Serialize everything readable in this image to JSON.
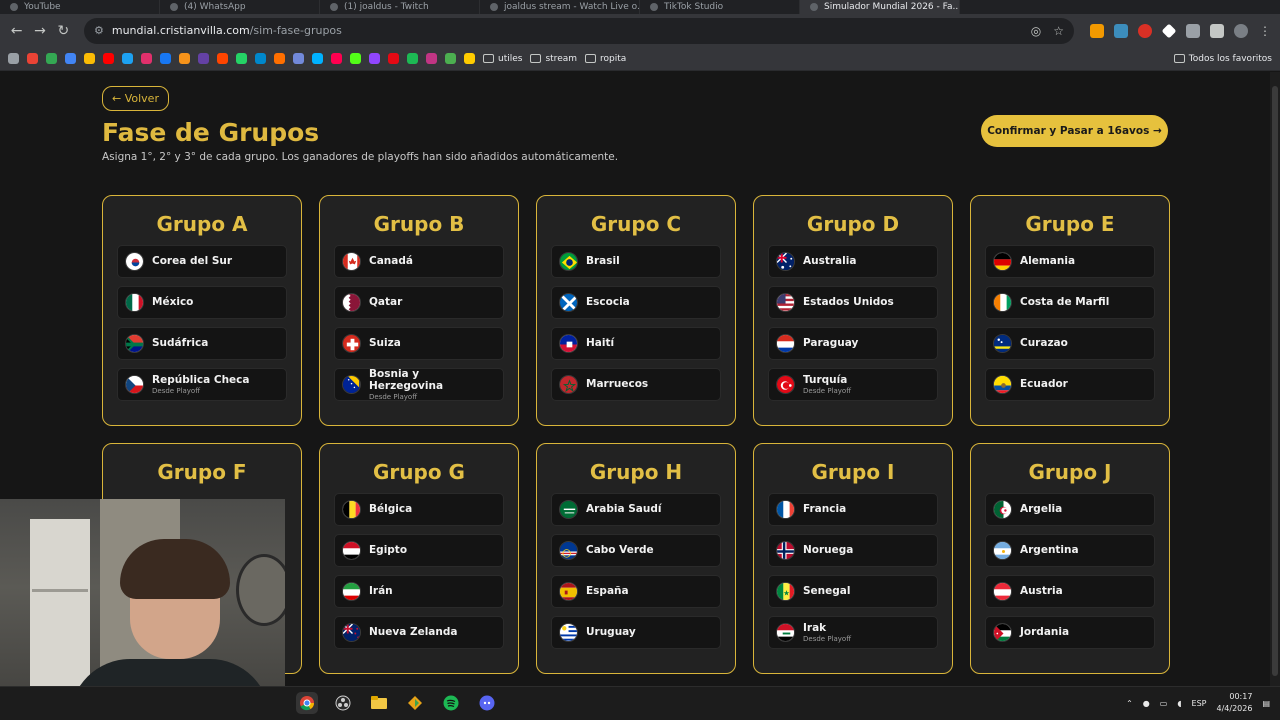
{
  "browser": {
    "tabs": [
      {
        "label": "YouTube",
        "active": false
      },
      {
        "label": "(4) WhatsApp",
        "active": false
      },
      {
        "label": "(1) joaldus - Twitch",
        "active": false
      },
      {
        "label": "joaldus stream - Watch Live o...",
        "active": false
      },
      {
        "label": "TikTok Studio",
        "active": false
      },
      {
        "label": "Simulador Mundial 2026 - Fa...",
        "active": true
      }
    ],
    "url_host": "mundial.cristianvilla.com",
    "url_path": "/sim-fase-grupos",
    "bookmark_folders": [
      "utiles",
      "stream",
      "ropita"
    ],
    "all_bookmarks_label": "Todos los favoritos"
  },
  "header": {
    "back_label": "← Volver",
    "title": "Fase de Grupos",
    "subtitle": "Asigna 1°, 2° y 3° de cada grupo. Los ganadores de playoffs han sido añadidos automáticamente.",
    "confirm_label": "Confirmar y Pasar a 16avos →"
  },
  "groups": [
    {
      "name": "Grupo A",
      "teams": [
        {
          "name": "Corea del Sur",
          "note": "",
          "flag": "kor"
        },
        {
          "name": "México",
          "note": "",
          "flag": "mex"
        },
        {
          "name": "Sudáfrica",
          "note": "",
          "flag": "rsa"
        },
        {
          "name": "República Checa",
          "note": "Desde Playoff",
          "flag": "cze"
        }
      ]
    },
    {
      "name": "Grupo B",
      "teams": [
        {
          "name": "Canadá",
          "note": "",
          "flag": "can"
        },
        {
          "name": "Qatar",
          "note": "",
          "flag": "qat"
        },
        {
          "name": "Suiza",
          "note": "",
          "flag": "sui"
        },
        {
          "name": "Bosnia y Herzegovina",
          "note": "Desde Playoff",
          "flag": "bih"
        }
      ]
    },
    {
      "name": "Grupo C",
      "teams": [
        {
          "name": "Brasil",
          "note": "",
          "flag": "bra"
        },
        {
          "name": "Escocia",
          "note": "",
          "flag": "sco"
        },
        {
          "name": "Haití",
          "note": "",
          "flag": "hai"
        },
        {
          "name": "Marruecos",
          "note": "",
          "flag": "mar"
        }
      ]
    },
    {
      "name": "Grupo D",
      "teams": [
        {
          "name": "Australia",
          "note": "",
          "flag": "aus"
        },
        {
          "name": "Estados Unidos",
          "note": "",
          "flag": "usa"
        },
        {
          "name": "Paraguay",
          "note": "",
          "flag": "par"
        },
        {
          "name": "Turquía",
          "note": "Desde Playoff",
          "flag": "tur"
        }
      ]
    },
    {
      "name": "Grupo E",
      "teams": [
        {
          "name": "Alemania",
          "note": "",
          "flag": "ger"
        },
        {
          "name": "Costa de Marfil",
          "note": "",
          "flag": "civ"
        },
        {
          "name": "Curazao",
          "note": "",
          "flag": "cuw"
        },
        {
          "name": "Ecuador",
          "note": "",
          "flag": "ecu"
        }
      ]
    },
    {
      "name": "Grupo F",
      "teams": []
    },
    {
      "name": "Grupo G",
      "teams": [
        {
          "name": "Bélgica",
          "note": "",
          "flag": "bel"
        },
        {
          "name": "Egipto",
          "note": "",
          "flag": "egy"
        },
        {
          "name": "Irán",
          "note": "",
          "flag": "irn"
        },
        {
          "name": "Nueva Zelanda",
          "note": "",
          "flag": "nzl"
        }
      ]
    },
    {
      "name": "Grupo H",
      "teams": [
        {
          "name": "Arabia Saudí",
          "note": "",
          "flag": "ksa"
        },
        {
          "name": "Cabo Verde",
          "note": "",
          "flag": "cpv"
        },
        {
          "name": "España",
          "note": "",
          "flag": "esp"
        },
        {
          "name": "Uruguay",
          "note": "",
          "flag": "uru"
        }
      ]
    },
    {
      "name": "Grupo I",
      "teams": [
        {
          "name": "Francia",
          "note": "",
          "flag": "fra"
        },
        {
          "name": "Noruega",
          "note": "",
          "flag": "nor"
        },
        {
          "name": "Senegal",
          "note": "",
          "flag": "sen"
        },
        {
          "name": "Irak",
          "note": "Desde Playoff",
          "flag": "irq"
        }
      ]
    },
    {
      "name": "Grupo J",
      "teams": [
        {
          "name": "Argelia",
          "note": "",
          "flag": "alg"
        },
        {
          "name": "Argentina",
          "note": "",
          "flag": "arg"
        },
        {
          "name": "Austria",
          "note": "",
          "flag": "aut"
        },
        {
          "name": "Jordania",
          "note": "",
          "flag": "jor"
        }
      ]
    }
  ],
  "taskbar": {
    "language": "ESP",
    "time": "00:17",
    "date": "4/4/2026"
  },
  "colors": {
    "accent": "#e2bf45",
    "background": "#161616",
    "card": "#222222"
  }
}
